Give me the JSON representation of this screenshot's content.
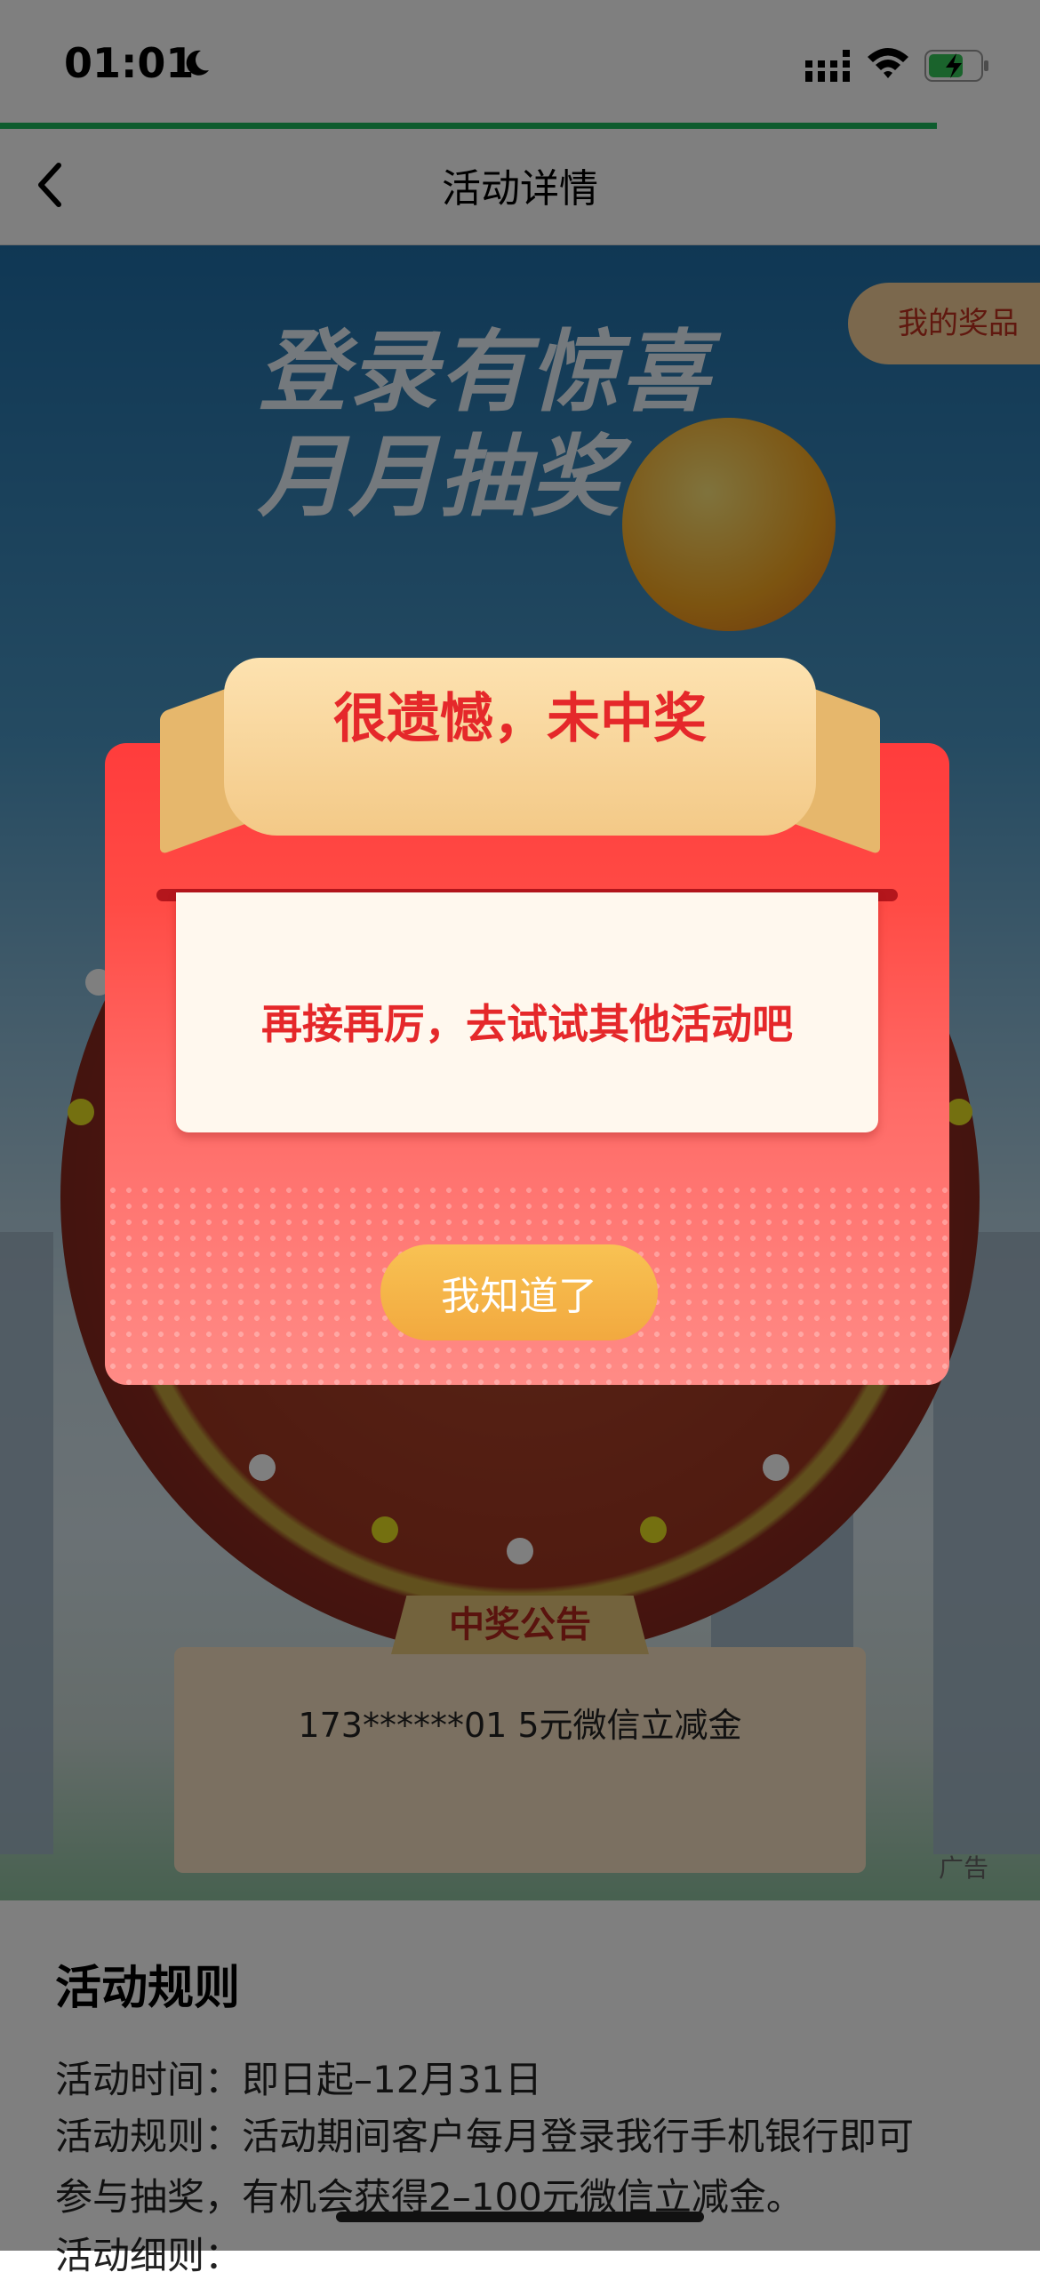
{
  "status_bar": {
    "time": "01:01"
  },
  "nav": {
    "title": "活动详情"
  },
  "hero": {
    "prize_button": "我的奖品",
    "banner_line1": "登录有惊喜",
    "banner_line2": "月月抽奖",
    "notice_title": "中奖公告",
    "notice_text": "173******01 5元微信立减金",
    "ad_label": "广告"
  },
  "rules": {
    "title": "活动规则",
    "line1": "活动时间：即日起–12月31日",
    "line2": "活动规则：活动期间客户每月登录我行手机银行即可",
    "line3": "参与抽奖，有机会获得2–100元微信立减金。",
    "line4": "活动细则："
  },
  "dialog": {
    "title": "很遗憾，未中奖",
    "message": "再接再厉，去试试其他活动吧",
    "ok_label": "我知道了"
  },
  "colors": {
    "accent_red": "#e5282a",
    "button_orange": "#f2a93f",
    "progress_green": "#1cb85c"
  }
}
